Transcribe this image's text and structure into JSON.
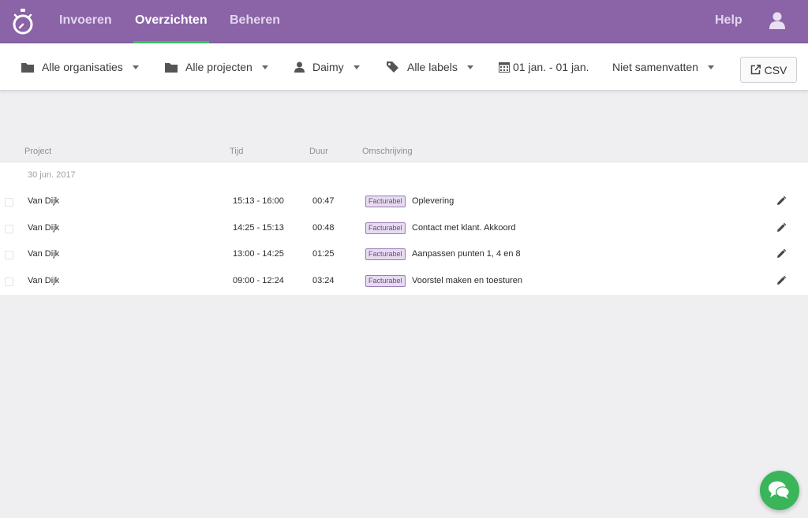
{
  "nav": {
    "items": [
      {
        "label": "Invoeren"
      },
      {
        "label": "Overzichten",
        "active": true
      },
      {
        "label": "Beheren"
      }
    ],
    "help": "Help",
    "logo_icon": "stopwatch-icon",
    "user_icon": "user-icon"
  },
  "filters": {
    "organisations": "Alle organisaties",
    "projects": "Alle projecten",
    "user": "Daimy",
    "labels": "Alle labels",
    "date_range": "01 jan. - 01 jan.",
    "summarize": "Niet samenvatten",
    "csv": "CSV"
  },
  "table": {
    "columns": {
      "project": "Project",
      "time": "Tijd",
      "duration": "Duur",
      "description": "Omschrijving"
    },
    "date_group": "30 jun. 2017",
    "rows": [
      {
        "project": "Van Dijk",
        "time": "15:13 - 16:00",
        "duration": "00:47",
        "badge": "Facturabel",
        "description": "Oplevering"
      },
      {
        "project": "Van Dijk",
        "time": "14:25 - 15:13",
        "duration": "00:48",
        "badge": "Facturabel",
        "description": "Contact met klant. Akkoord"
      },
      {
        "project": "Van Dijk",
        "time": "13:00 - 14:25",
        "duration": "01:25",
        "badge": "Facturabel",
        "description": "Aanpassen punten 1, 4 en 8"
      },
      {
        "project": "Van Dijk",
        "time": "09:00 - 12:24",
        "duration": "03:24",
        "badge": "Facturabel",
        "description": "Voorstel maken en toesturen"
      }
    ]
  },
  "colors": {
    "header_bg": "#8a64a6",
    "active_underline": "#3bbf5f",
    "badge_bg": "#e6dbef",
    "chat_bg": "#3bb55a"
  }
}
